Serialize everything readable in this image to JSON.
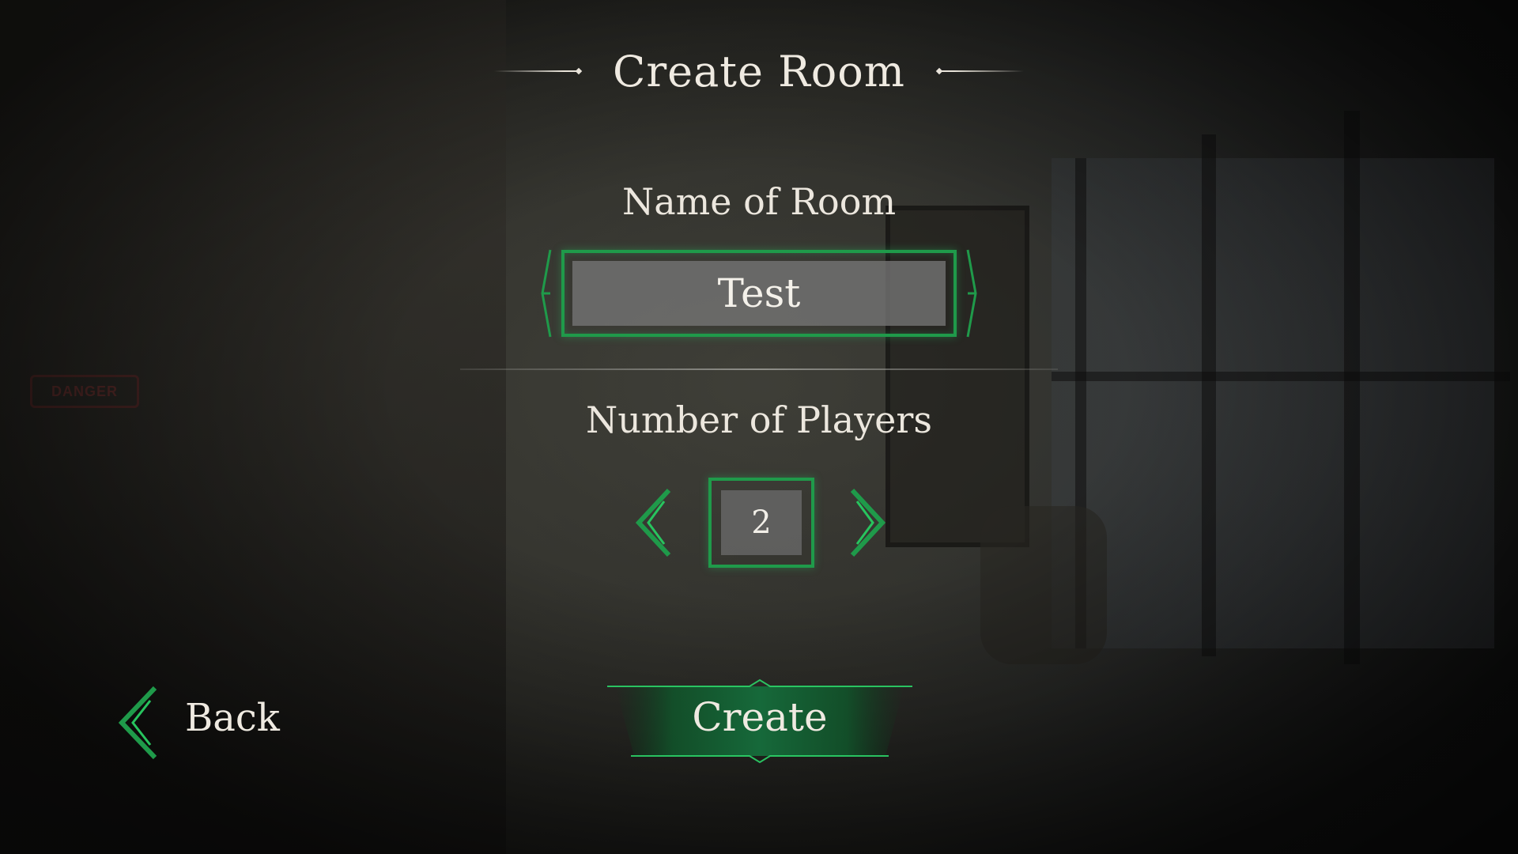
{
  "screen": {
    "title": "Create Room"
  },
  "room_name": {
    "label": "Name of Room",
    "value": "Test"
  },
  "players": {
    "label": "Number of Players",
    "value": "2"
  },
  "buttons": {
    "back": "Back",
    "create": "Create"
  },
  "background": {
    "sign_text": "DANGER"
  },
  "colors": {
    "accent_green": "#1f9a4a",
    "text": "#efeae1",
    "field_bg": "#767676"
  },
  "icons": {
    "decrease": "chevron-left-icon",
    "increase": "chevron-right-icon",
    "back": "chevron-left-icon"
  }
}
